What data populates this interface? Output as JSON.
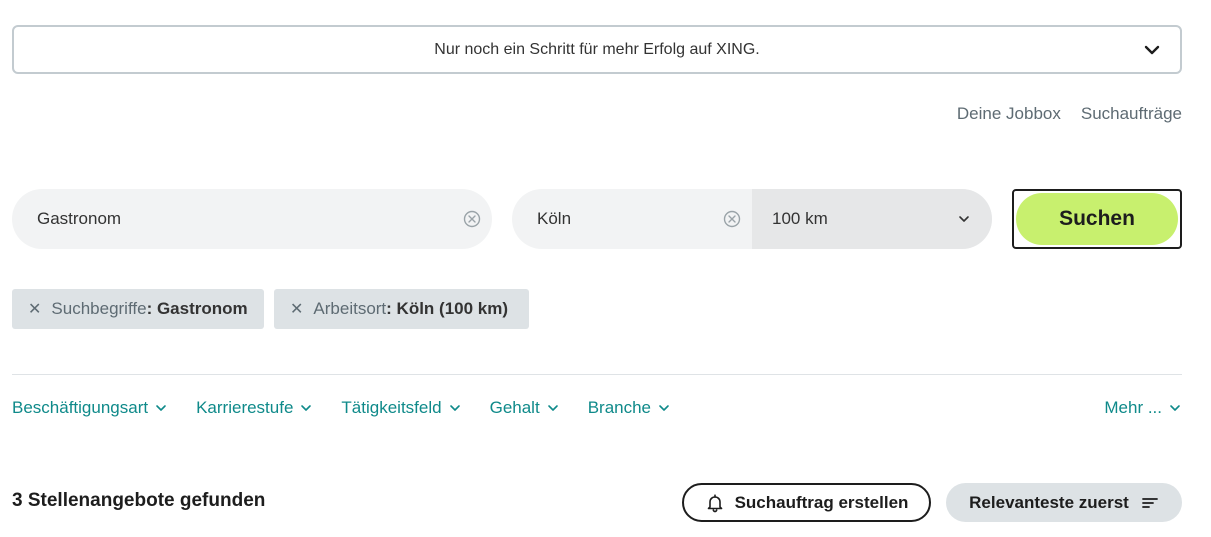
{
  "banner": {
    "text": "Nur noch ein Schritt für mehr Erfolg auf XING.",
    "icon": "chevron-down-icon"
  },
  "toplinks": {
    "jobbox": "Deine Jobbox",
    "searches": "Suchaufträge"
  },
  "search": {
    "keyword_value": "Gastronom",
    "location_value": "Köln",
    "radius_value": "100 km",
    "submit_label": "Suchen"
  },
  "chips": [
    {
      "label": "Suchbegriffe",
      "value": ": Gastronom"
    },
    {
      "label": "Arbeitsort",
      "value": ": Köln (100 km)"
    }
  ],
  "filters": [
    {
      "label": "Beschäftigungsart"
    },
    {
      "label": "Karrierestufe"
    },
    {
      "label": "Tätigkeitsfeld"
    },
    {
      "label": "Gehalt"
    },
    {
      "label": "Branche"
    }
  ],
  "more_label": "Mehr ...",
  "results": {
    "count_text": "3 Stellenangebote gefunden"
  },
  "actions": {
    "alert_label": "Suchauftrag erstellen",
    "sort_label": "Relevanteste zuerst"
  },
  "colors": {
    "accent_green": "#c8f06e",
    "link_teal": "#0f8a8a",
    "chip_bg": "#dde2e5",
    "field_bg": "#f2f3f4"
  }
}
